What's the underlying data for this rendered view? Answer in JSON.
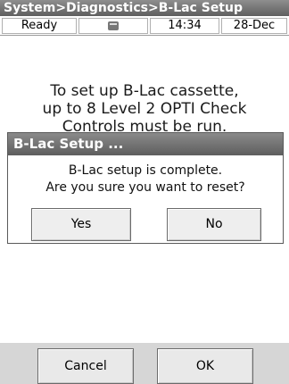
{
  "header": {
    "breadcrumb": "System>Diagnostics>B-Lac Setup"
  },
  "status": {
    "state": "Ready",
    "icon": "cassette-icon",
    "time": "14:34",
    "date": "28-Dec"
  },
  "main": {
    "message": "To set up B-Lac cassette,\nup to 8 Level 2 OPTI Check\nControls must be run."
  },
  "dialog": {
    "title": "B-Lac Setup ...",
    "message": "B-Lac setup is complete.\nAre you sure you want to reset?",
    "yes_label": "Yes",
    "no_label": "No"
  },
  "footer": {
    "cancel_label": "Cancel",
    "ok_label": "OK"
  }
}
